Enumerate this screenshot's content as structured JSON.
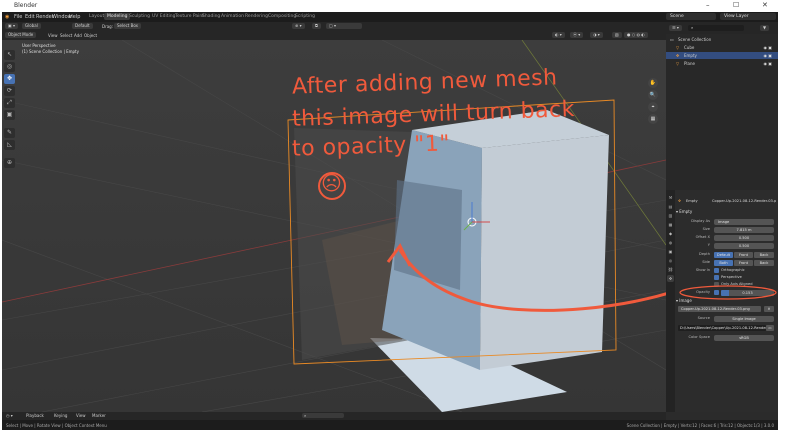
{
  "window": {
    "title": "Blender",
    "min": "–",
    "max": "☐",
    "close": "✕"
  },
  "menu": [
    "File",
    "Edit",
    "Render",
    "Window",
    "Help"
  ],
  "workspaces": [
    "Layout",
    "Modeling",
    "Sculpting",
    "UV Editing",
    "Texture Paint",
    "Shading",
    "Animation",
    "Rendering",
    "Compositing",
    "Scripting"
  ],
  "active_workspace": "Modeling",
  "scene": {
    "name": "Scene",
    "view_layer": "View Layer"
  },
  "header": {
    "mode": "Object Mode",
    "view": "View",
    "select": "Select",
    "add": "Add",
    "object": "Object",
    "orientation": "Global",
    "drag": "Drag:",
    "drag_value": "Select Box",
    "transform": "Default"
  },
  "viewport": {
    "perspective": "User Perspective",
    "collection": "(1) Scene Collection | Empty"
  },
  "tools": [
    "↖",
    "◎",
    "✥",
    "⟳",
    "⤢",
    "▣",
    "✎",
    "◺",
    "⊕"
  ],
  "nav": [
    "✋",
    "🔍",
    "⌖",
    "▦"
  ],
  "outliner": {
    "header": "Scene Collection",
    "items": [
      {
        "name": "Scene Collection",
        "indent": 0,
        "selected": false
      },
      {
        "name": "Cube",
        "indent": 1,
        "selected": false
      },
      {
        "name": "Empty",
        "indent": 1,
        "selected": true
      },
      {
        "name": "Plane",
        "indent": 1,
        "selected": false
      }
    ]
  },
  "properties": {
    "object_name": "Empty",
    "image_name": "Copper-Up-2021-08-12-Render-03.png",
    "section_empty": "Empty",
    "display_as_label": "Display As",
    "display_as": "Image",
    "size_label": "Size",
    "size": "7.815 m",
    "offset_x_label": "Offset X",
    "offset_x": "0.500",
    "offset_y_label": "Y",
    "offset_y": "0.500",
    "depth_label": "Depth",
    "depth_opts": [
      "Default",
      "Front",
      "Back"
    ],
    "side_label": "Side",
    "side_opts": [
      "Both",
      "Front",
      "Back"
    ],
    "show_in_label": "Show In",
    "show_in": [
      "Orthographic",
      "Perspective",
      "Only Axis Aligned"
    ],
    "opacity_label": "Opacity",
    "opacity": "0.153",
    "section_image": "Image",
    "filepath": "D:\\Users\\Blender\\Copper\\Up-2021-08-12-Render-03.png",
    "source_label": "Source",
    "source": "Single Image",
    "colorspace_label": "Color Space",
    "colorspace": "sRGB"
  },
  "timeline": {
    "playback": "Playback",
    "keying": "Keying",
    "view": "View",
    "marker": "Marker"
  },
  "status": {
    "left": "Select  |  Move  |  Rotate View  |  Object Context Menu",
    "right": "Scene Collection | Empty | Verts:12 | Faces:6 | Tris:12 | Objects:1/3 | 3.0.0"
  },
  "annotation": {
    "line1": "After adding new mesh",
    "line2": "this image will turn back",
    "line3": "to opacity \"1\"",
    "face": "☹"
  },
  "colors": {
    "accent": "#4772b3",
    "annotation": "#f05a3c",
    "selection": "#334d80"
  }
}
